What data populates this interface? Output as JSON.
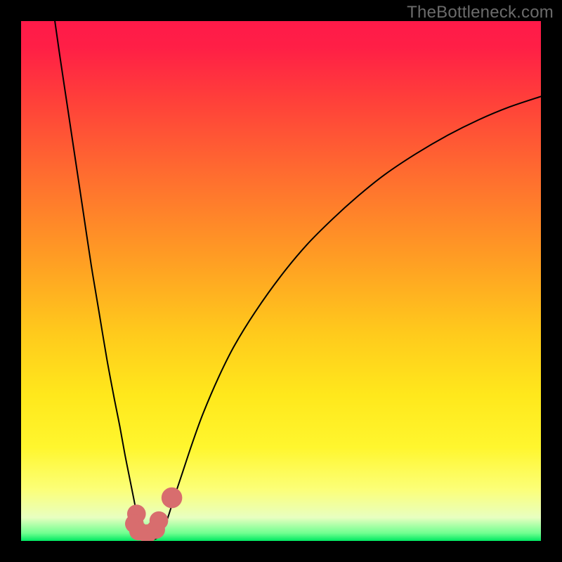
{
  "watermark": "TheBottleneck.com",
  "chart_data": {
    "type": "line",
    "title": "",
    "xlabel": "",
    "ylabel": "",
    "xlim": [
      0,
      100
    ],
    "ylim": [
      0,
      100
    ],
    "background_gradient": {
      "stops": [
        {
          "offset": 0.0,
          "color": "#ff1a49"
        },
        {
          "offset": 0.05,
          "color": "#ff1f46"
        },
        {
          "offset": 0.15,
          "color": "#ff3f3a"
        },
        {
          "offset": 0.3,
          "color": "#ff6e2f"
        },
        {
          "offset": 0.45,
          "color": "#ff9b24"
        },
        {
          "offset": 0.6,
          "color": "#ffca1c"
        },
        {
          "offset": 0.72,
          "color": "#ffe81c"
        },
        {
          "offset": 0.82,
          "color": "#fff62e"
        },
        {
          "offset": 0.9,
          "color": "#fcff77"
        },
        {
          "offset": 0.955,
          "color": "#e8ffc0"
        },
        {
          "offset": 0.985,
          "color": "#70ff90"
        },
        {
          "offset": 1.0,
          "color": "#00e862"
        }
      ]
    },
    "series": [
      {
        "name": "bottleneck-curve",
        "color": "#000000",
        "width": 2.0,
        "points": [
          {
            "x": 6.5,
            "y": 100.0
          },
          {
            "x": 7.5,
            "y": 93.0
          },
          {
            "x": 9.0,
            "y": 83.0
          },
          {
            "x": 10.5,
            "y": 73.0
          },
          {
            "x": 12.0,
            "y": 63.0
          },
          {
            "x": 13.5,
            "y": 53.0
          },
          {
            "x": 15.0,
            "y": 44.0
          },
          {
            "x": 16.5,
            "y": 35.0
          },
          {
            "x": 18.0,
            "y": 27.0
          },
          {
            "x": 19.0,
            "y": 22.0
          },
          {
            "x": 20.0,
            "y": 16.5
          },
          {
            "x": 21.0,
            "y": 11.5
          },
          {
            "x": 21.7,
            "y": 8.0
          },
          {
            "x": 22.3,
            "y": 5.0
          },
          {
            "x": 23.0,
            "y": 2.8
          },
          {
            "x": 23.8,
            "y": 1.3
          },
          {
            "x": 24.5,
            "y": 0.6
          },
          {
            "x": 25.3,
            "y": 0.3
          },
          {
            "x": 26.2,
            "y": 0.6
          },
          {
            "x": 27.0,
            "y": 1.6
          },
          {
            "x": 27.8,
            "y": 3.3
          },
          {
            "x": 28.5,
            "y": 5.3
          },
          {
            "x": 29.5,
            "y": 8.5
          },
          {
            "x": 31.0,
            "y": 13.0
          },
          {
            "x": 33.0,
            "y": 19.0
          },
          {
            "x": 35.0,
            "y": 24.5
          },
          {
            "x": 38.0,
            "y": 31.5
          },
          {
            "x": 41.0,
            "y": 37.5
          },
          {
            "x": 45.0,
            "y": 44.0
          },
          {
            "x": 50.0,
            "y": 51.0
          },
          {
            "x": 55.0,
            "y": 57.0
          },
          {
            "x": 60.0,
            "y": 62.0
          },
          {
            "x": 65.0,
            "y": 66.5
          },
          {
            "x": 70.0,
            "y": 70.5
          },
          {
            "x": 76.0,
            "y": 74.5
          },
          {
            "x": 82.0,
            "y": 78.0
          },
          {
            "x": 88.0,
            "y": 81.0
          },
          {
            "x": 94.0,
            "y": 83.5
          },
          {
            "x": 100.0,
            "y": 85.5
          }
        ]
      }
    ],
    "markers": [
      {
        "name": "left-top-marker",
        "x": 22.2,
        "y": 5.2,
        "r": 1.8,
        "color": "#d86d6e"
      },
      {
        "name": "left-side-marker",
        "x": 21.8,
        "y": 3.3,
        "r": 1.8,
        "color": "#d86d6e"
      },
      {
        "name": "left-bottom-marker",
        "x": 22.6,
        "y": 1.9,
        "r": 1.8,
        "color": "#d86d6e"
      },
      {
        "name": "mid-marker",
        "x": 24.3,
        "y": 1.4,
        "r": 1.8,
        "color": "#d86d6e"
      },
      {
        "name": "right-bottom-marker",
        "x": 25.9,
        "y": 2.2,
        "r": 1.8,
        "color": "#d86d6e"
      },
      {
        "name": "right-side-marker",
        "x": 26.5,
        "y": 3.9,
        "r": 1.8,
        "color": "#d86d6e"
      },
      {
        "name": "right-top-marker",
        "x": 29.0,
        "y": 8.3,
        "r": 2.0,
        "color": "#d86d6e"
      }
    ]
  }
}
